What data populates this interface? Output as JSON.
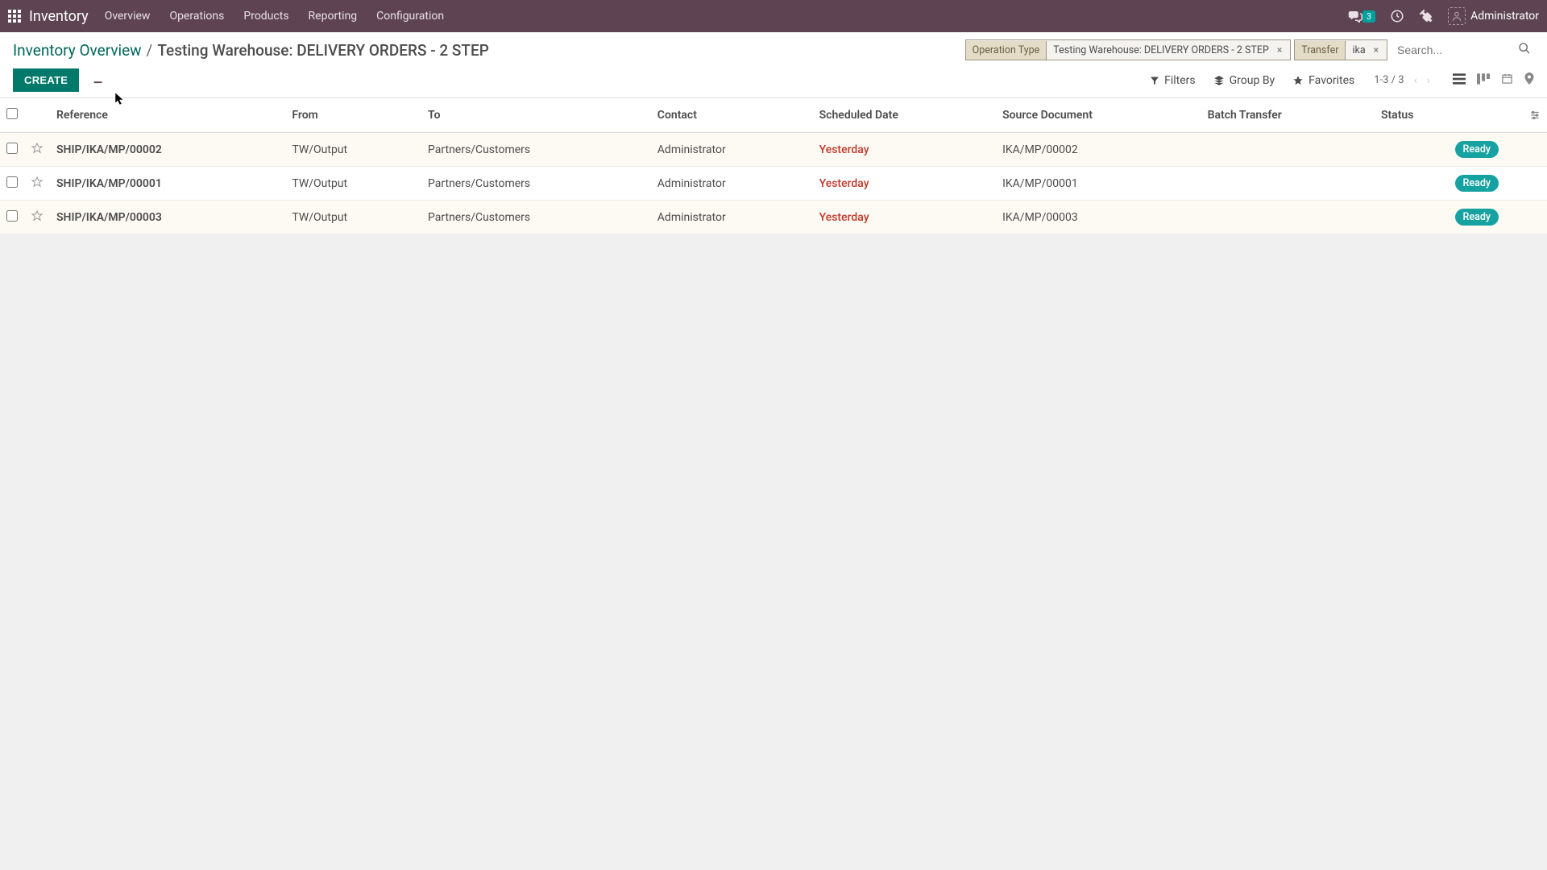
{
  "module": "Inventory",
  "nav": {
    "links": [
      "Overview",
      "Operations",
      "Products",
      "Reporting",
      "Configuration"
    ],
    "messages_count": "3",
    "user": "Administrator"
  },
  "breadcrumb": {
    "parent": "Inventory Overview",
    "current": "Testing Warehouse: DELIVERY ORDERS - 2 STEP"
  },
  "search": {
    "facets": [
      {
        "label": "Operation Type",
        "value": "Testing Warehouse: DELIVERY ORDERS - 2 STEP"
      },
      {
        "label": "Transfer",
        "value": "ika"
      }
    ],
    "placeholder": "Search..."
  },
  "buttons": {
    "create": "CREATE",
    "filters": "Filters",
    "groupby": "Group By",
    "favorites": "Favorites"
  },
  "pager": "1-3 / 3",
  "table": {
    "headers": {
      "reference": "Reference",
      "from": "From",
      "to": "To",
      "contact": "Contact",
      "scheduled": "Scheduled Date",
      "source": "Source Document",
      "batch": "Batch Transfer",
      "status": "Status"
    },
    "rows": [
      {
        "reference": "SHIP/IKA/MP/00002",
        "from": "TW/Output",
        "to": "Partners/Customers",
        "contact": "Administrator",
        "scheduled": "Yesterday",
        "source": "IKA/MP/00002",
        "batch": "",
        "status": "Ready"
      },
      {
        "reference": "SHIP/IKA/MP/00001",
        "from": "TW/Output",
        "to": "Partners/Customers",
        "contact": "Administrator",
        "scheduled": "Yesterday",
        "source": "IKA/MP/00001",
        "batch": "",
        "status": "Ready"
      },
      {
        "reference": "SHIP/IKA/MP/00003",
        "from": "TW/Output",
        "to": "Partners/Customers",
        "contact": "Administrator",
        "scheduled": "Yesterday",
        "source": "IKA/MP/00003",
        "batch": "",
        "status": "Ready"
      }
    ]
  }
}
